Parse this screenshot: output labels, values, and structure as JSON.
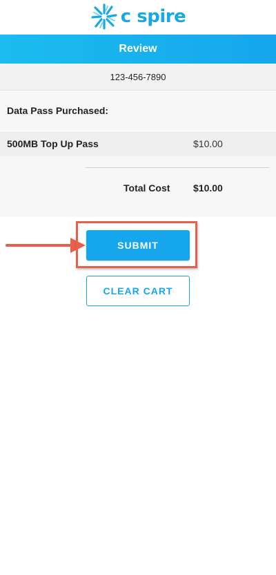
{
  "brand": {
    "logo_text": "c spire",
    "logo_icon": "starburst-logo-icon",
    "accent_color": "#16a6ec"
  },
  "header": {
    "title": "Review"
  },
  "account": {
    "phone_number": "123-456-7890"
  },
  "order": {
    "section_label": "Data Pass Purchased:",
    "items": [
      {
        "name": "500MB Top Up Pass",
        "price": "$10.00"
      }
    ],
    "total_label": "Total Cost",
    "total_value": "$10.00"
  },
  "actions": {
    "submit_label": "SUBMIT",
    "clear_label": "CLEAR CART",
    "annotation_color": "#e8604c",
    "annotation_icon": "arrow-right-icon"
  }
}
